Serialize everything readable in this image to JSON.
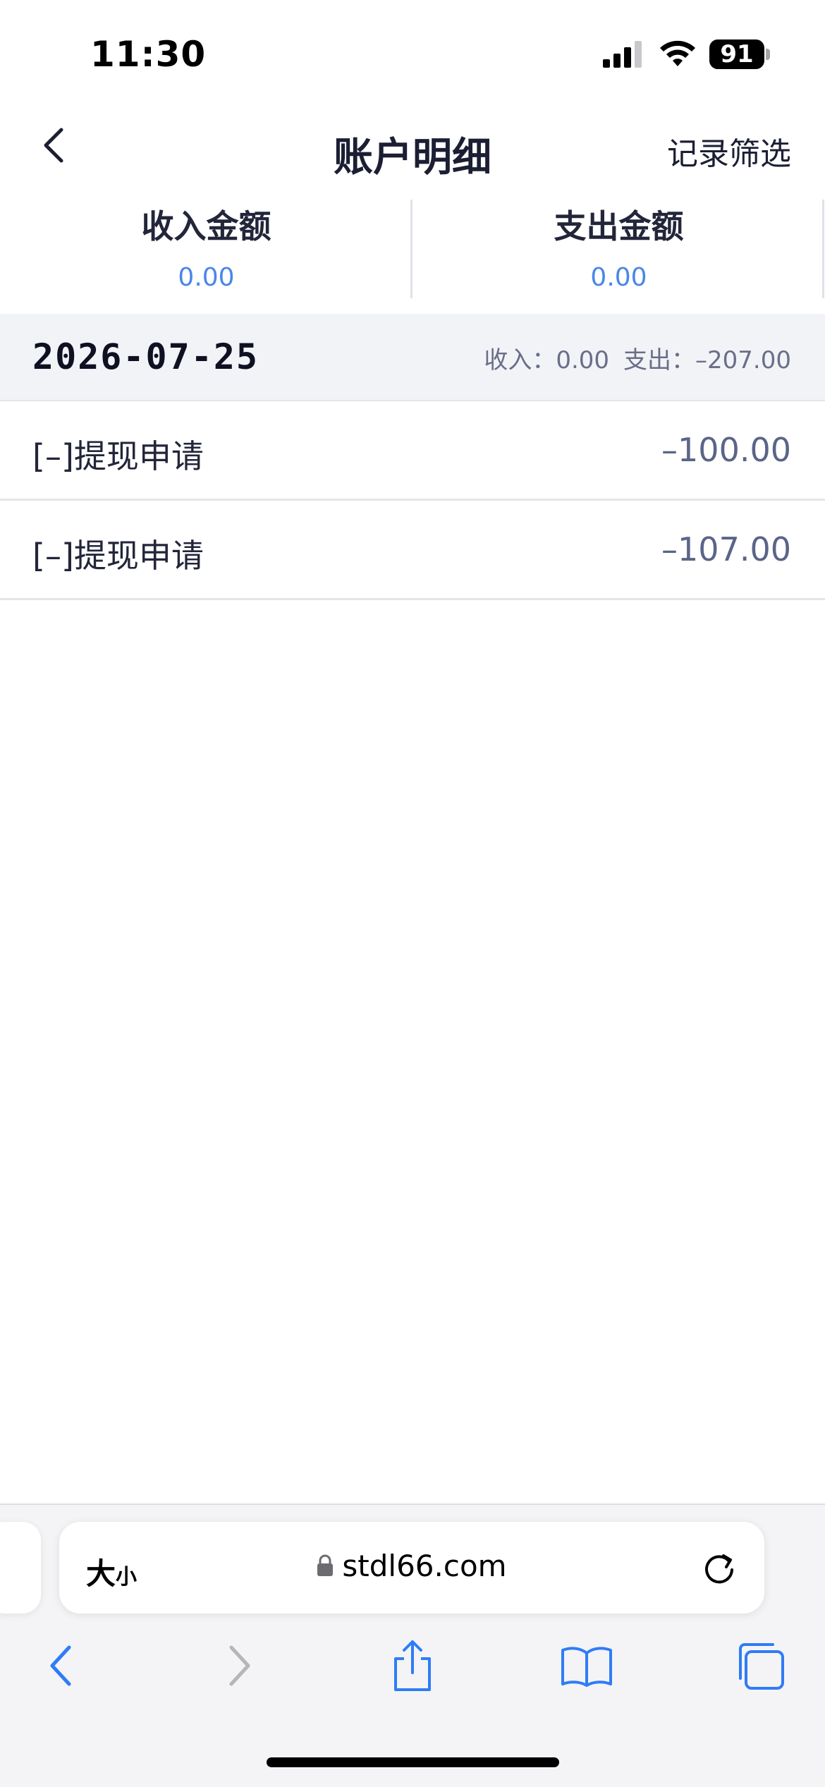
{
  "status_bar": {
    "time": "11:30",
    "battery": "91"
  },
  "nav": {
    "title": "账户明细",
    "filter_label": "记录筛选"
  },
  "summary": {
    "income_label": "收入金额",
    "income_value": "0.00",
    "expense_label": "支出金额",
    "expense_value": "0.00"
  },
  "date_group": {
    "date": "2026-07-25",
    "income_text": "收入：0.00",
    "expense_text": "支出：–207.00"
  },
  "records": [
    {
      "title": "[–]提现申请",
      "amount": "–100.00"
    },
    {
      "title": "[–]提现申请",
      "amount": "–107.00"
    }
  ],
  "browser": {
    "text_size_big": "大",
    "text_size_small": "小",
    "url": "stdl66.com"
  },
  "colors": {
    "accent_blue": "#4a86e8",
    "amount_gray": "#5b6488",
    "ios_blue": "#2f7cf6"
  }
}
